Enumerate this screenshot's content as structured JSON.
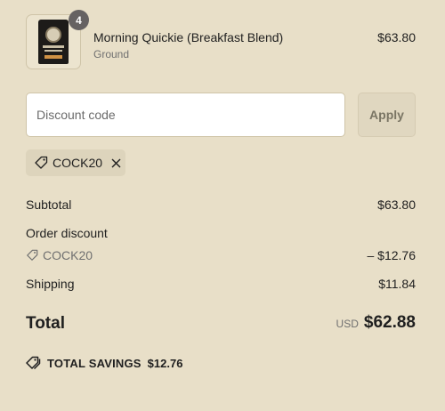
{
  "product": {
    "quantity": "4",
    "name": "Morning Quickie (Breakfast Blend)",
    "variant": "Ground",
    "price": "$63.80"
  },
  "discount": {
    "placeholder": "Discount code",
    "apply_label": "Apply",
    "applied_code": "COCK20"
  },
  "summary": {
    "subtotal_label": "Subtotal",
    "subtotal_value": "$63.80",
    "order_discount_label": "Order discount",
    "discount_code": "COCK20",
    "discount_value": "– $12.76",
    "shipping_label": "Shipping",
    "shipping_value": "$11.84",
    "total_label": "Total",
    "currency": "USD",
    "total_value": "$62.88",
    "savings_label": "TOTAL SAVINGS",
    "savings_value": "$12.76"
  },
  "icons": {
    "tag": "tag-icon",
    "close": "close-icon",
    "savings": "savings-tag-icon"
  },
  "colors": {
    "background": "#e8dfc8",
    "badge": "#666262",
    "chip": "#ddd4bc"
  }
}
